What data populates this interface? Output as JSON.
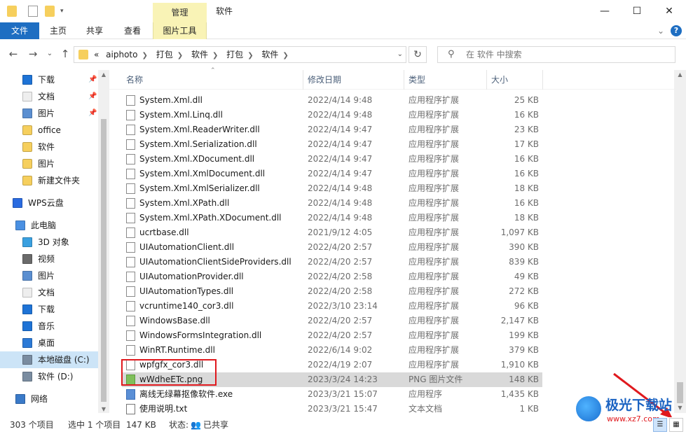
{
  "titlebar": {
    "context_tab": "管理",
    "title": "软件",
    "min": "—",
    "max": "☐",
    "close": "✕"
  },
  "ribbon": {
    "tabs": [
      "文件",
      "主页",
      "共享",
      "查看",
      "图片工具"
    ],
    "expand": "⌄",
    "help": "?"
  },
  "nav": {
    "back": "←",
    "forward": "→",
    "recent": "⌄",
    "up": "↑",
    "crumbs": [
      "«",
      "aiphoto",
      "打包",
      "软件",
      "打包",
      "软件"
    ],
    "refresh": "↻",
    "search_placeholder": "在 软件 中搜索"
  },
  "sidebar": {
    "items": [
      {
        "label": "下载",
        "icon": "download-icon",
        "pinned": true
      },
      {
        "label": "文档",
        "icon": "document-icon",
        "pinned": true
      },
      {
        "label": "图片",
        "icon": "pictures-icon",
        "pinned": true
      },
      {
        "label": "office",
        "icon": "folder-icon"
      },
      {
        "label": "软件",
        "icon": "folder-icon"
      },
      {
        "label": "图片",
        "icon": "folder-icon"
      },
      {
        "label": "新建文件夹",
        "icon": "folder-icon"
      },
      {
        "label": "WPS云盘",
        "icon": "cloud-icon"
      },
      {
        "label": "此电脑",
        "icon": "computer-icon"
      },
      {
        "label": "3D 对象",
        "icon": "3d-objects-icon"
      },
      {
        "label": "视频",
        "icon": "video-icon"
      },
      {
        "label": "图片",
        "icon": "pictures-icon"
      },
      {
        "label": "文档",
        "icon": "document-icon"
      },
      {
        "label": "下载",
        "icon": "download-icon"
      },
      {
        "label": "音乐",
        "icon": "music-icon"
      },
      {
        "label": "桌面",
        "icon": "desktop-icon"
      },
      {
        "label": "本地磁盘 (C:)",
        "icon": "drive-icon",
        "selected": true
      },
      {
        "label": "软件 (D:)",
        "icon": "drive-icon"
      },
      {
        "label": "网络",
        "icon": "network-icon"
      }
    ]
  },
  "columns": {
    "name": "名称",
    "date": "修改日期",
    "type": "类型",
    "size": "大小"
  },
  "files": [
    {
      "name": "System.Xml.dll",
      "date": "2022/4/14 9:48",
      "type": "应用程序扩展",
      "size": "25 KB",
      "kind": "dll"
    },
    {
      "name": "System.Xml.Linq.dll",
      "date": "2022/4/14 9:48",
      "type": "应用程序扩展",
      "size": "16 KB",
      "kind": "dll"
    },
    {
      "name": "System.Xml.ReaderWriter.dll",
      "date": "2022/4/14 9:47",
      "type": "应用程序扩展",
      "size": "23 KB",
      "kind": "dll"
    },
    {
      "name": "System.Xml.Serialization.dll",
      "date": "2022/4/14 9:47",
      "type": "应用程序扩展",
      "size": "17 KB",
      "kind": "dll"
    },
    {
      "name": "System.Xml.XDocument.dll",
      "date": "2022/4/14 9:47",
      "type": "应用程序扩展",
      "size": "16 KB",
      "kind": "dll"
    },
    {
      "name": "System.Xml.XmlDocument.dll",
      "date": "2022/4/14 9:47",
      "type": "应用程序扩展",
      "size": "16 KB",
      "kind": "dll"
    },
    {
      "name": "System.Xml.XmlSerializer.dll",
      "date": "2022/4/14 9:48",
      "type": "应用程序扩展",
      "size": "18 KB",
      "kind": "dll"
    },
    {
      "name": "System.Xml.XPath.dll",
      "date": "2022/4/14 9:48",
      "type": "应用程序扩展",
      "size": "16 KB",
      "kind": "dll"
    },
    {
      "name": "System.Xml.XPath.XDocument.dll",
      "date": "2022/4/14 9:48",
      "type": "应用程序扩展",
      "size": "18 KB",
      "kind": "dll"
    },
    {
      "name": "ucrtbase.dll",
      "date": "2021/9/12 4:05",
      "type": "应用程序扩展",
      "size": "1,097 KB",
      "kind": "dll"
    },
    {
      "name": "UIAutomationClient.dll",
      "date": "2022/4/20 2:57",
      "type": "应用程序扩展",
      "size": "390 KB",
      "kind": "dll"
    },
    {
      "name": "UIAutomationClientSideProviders.dll",
      "date": "2022/4/20 2:57",
      "type": "应用程序扩展",
      "size": "839 KB",
      "kind": "dll"
    },
    {
      "name": "UIAutomationProvider.dll",
      "date": "2022/4/20 2:58",
      "type": "应用程序扩展",
      "size": "49 KB",
      "kind": "dll"
    },
    {
      "name": "UIAutomationTypes.dll",
      "date": "2022/4/20 2:58",
      "type": "应用程序扩展",
      "size": "272 KB",
      "kind": "dll"
    },
    {
      "name": "vcruntime140_cor3.dll",
      "date": "2022/3/10 23:14",
      "type": "应用程序扩展",
      "size": "96 KB",
      "kind": "dll"
    },
    {
      "name": "WindowsBase.dll",
      "date": "2022/4/20 2:57",
      "type": "应用程序扩展",
      "size": "2,147 KB",
      "kind": "dll"
    },
    {
      "name": "WindowsFormsIntegration.dll",
      "date": "2022/4/20 2:57",
      "type": "应用程序扩展",
      "size": "199 KB",
      "kind": "dll"
    },
    {
      "name": "WinRT.Runtime.dll",
      "date": "2022/6/14 9:02",
      "type": "应用程序扩展",
      "size": "379 KB",
      "kind": "dll"
    },
    {
      "name": "wpfgfx_cor3.dll",
      "date": "2022/4/19 2:07",
      "type": "应用程序扩展",
      "size": "1,910 KB",
      "kind": "dll"
    },
    {
      "name": "wWdheETc.png",
      "date": "2023/3/24 14:23",
      "type": "PNG 图片文件",
      "size": "148 KB",
      "kind": "png",
      "selected": true
    },
    {
      "name": "离线无绿幕抠像软件.exe",
      "date": "2023/3/21 15:07",
      "type": "应用程序",
      "size": "1,435 KB",
      "kind": "exe"
    },
    {
      "name": "使用说明.txt",
      "date": "2023/3/21 15:47",
      "type": "文本文档",
      "size": "1 KB",
      "kind": "txt"
    }
  ],
  "status": {
    "count": "303 个项目",
    "selected": "选中 1 个项目",
    "size": "147 KB",
    "state_label": "状态:",
    "share": "已共享"
  },
  "watermark": {
    "title": "极光下载站",
    "url": "www.xz7.com"
  }
}
